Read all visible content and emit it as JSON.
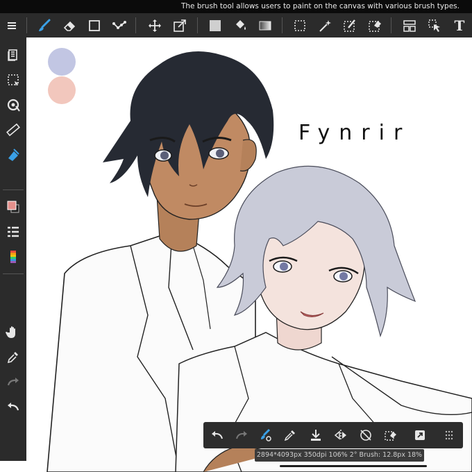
{
  "tooltip": {
    "text": "The brush tool allows users to paint on the canvas with various brush types."
  },
  "toolbar": {
    "items": [
      {
        "icon": "menu-icon"
      },
      {
        "icon": "brush-icon",
        "active": true
      },
      {
        "icon": "eraser-icon"
      },
      {
        "icon": "rectangle-icon"
      },
      {
        "icon": "lasso-dots-icon"
      },
      {
        "icon": "move-icon"
      },
      {
        "icon": "transform-icon"
      },
      {
        "icon": "fill-color-icon"
      },
      {
        "icon": "bucket-icon"
      },
      {
        "icon": "gradient-icon"
      },
      {
        "icon": "selection-icon"
      },
      {
        "icon": "magic-wand-icon"
      },
      {
        "icon": "select-pen-icon"
      },
      {
        "icon": "select-eraser-icon"
      },
      {
        "icon": "layout-icon"
      },
      {
        "icon": "pointer-icon"
      },
      {
        "icon": "text-icon"
      }
    ],
    "text_tool_label": "T"
  },
  "sidebar": {
    "items": [
      "layers-icon",
      "selection-area-icon",
      "snap-icon",
      "ruler-icon",
      "fill-tool-icon",
      "color-swatch-icon",
      "layer-list-icon",
      "rainbow-icon",
      "hand-icon",
      "eyedropper-icon",
      "redo-icon",
      "undo-icon"
    ]
  },
  "canvas": {
    "title_text": "Fynrir",
    "palette": [
      "#c2c6e3",
      "#f2c7bd"
    ],
    "colors": {
      "hair_dark": "#262a33",
      "skin_dark": "#b5815a",
      "hair_silver": "#c9cbd8",
      "skin_light": "#f3e2dc"
    }
  },
  "floatbar": {
    "items": [
      "undo-icon",
      "redo-icon",
      "brush-settings-icon",
      "eyedropper-icon",
      "download-icon",
      "flip-icon",
      "no-rotate-icon",
      "select-edit-icon",
      "expand-icon",
      "grid-dots-icon"
    ]
  },
  "status": {
    "text": "2894*4093px 350dpi 106% 2° Brush: 12.8px 18%"
  },
  "colors": {
    "accent": "#3aa0e6",
    "toolbar_bg": "#2b2b2b"
  }
}
